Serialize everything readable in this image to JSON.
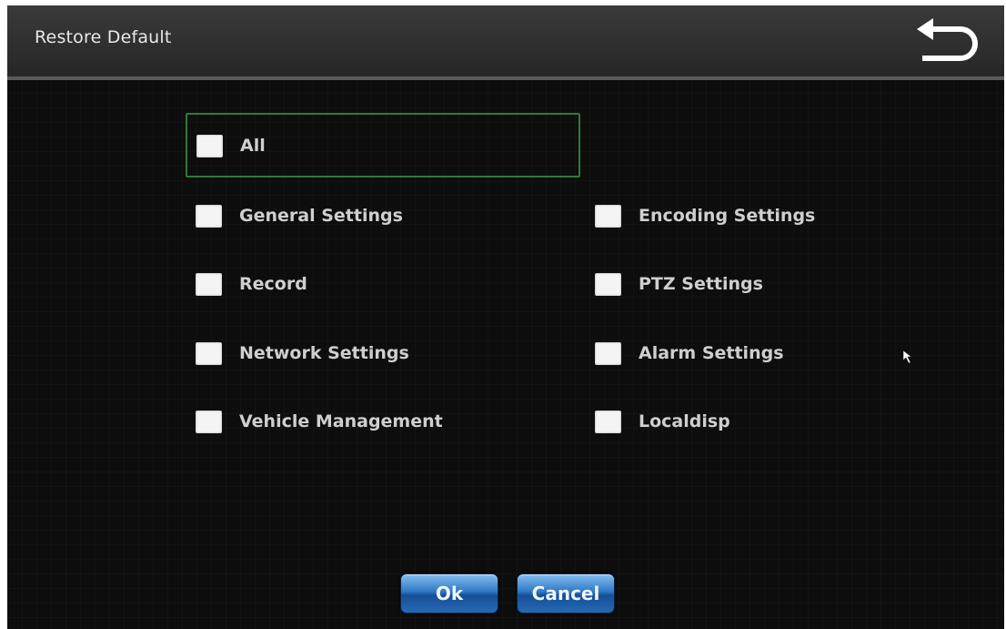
{
  "window": {
    "title": "Restore Default",
    "back_icon": "return-arrow-icon"
  },
  "options": {
    "all": {
      "label": "All",
      "checked": false
    },
    "left": [
      {
        "label": "General Settings",
        "checked": false
      },
      {
        "label": "Record",
        "checked": false
      },
      {
        "label": "Network Settings",
        "checked": false
      },
      {
        "label": "Vehicle Management",
        "checked": false
      }
    ],
    "right": [
      {
        "label": "Encoding Settings",
        "checked": false
      },
      {
        "label": "PTZ Settings",
        "checked": false
      },
      {
        "label": "Alarm Settings",
        "checked": false
      },
      {
        "label": "Localdisp",
        "checked": false
      }
    ]
  },
  "buttons": {
    "ok_label": "Ok",
    "cancel_label": "Cancel"
  },
  "colors": {
    "focus_border": "#2f7a3a",
    "button_blue": "#2f78c6"
  }
}
